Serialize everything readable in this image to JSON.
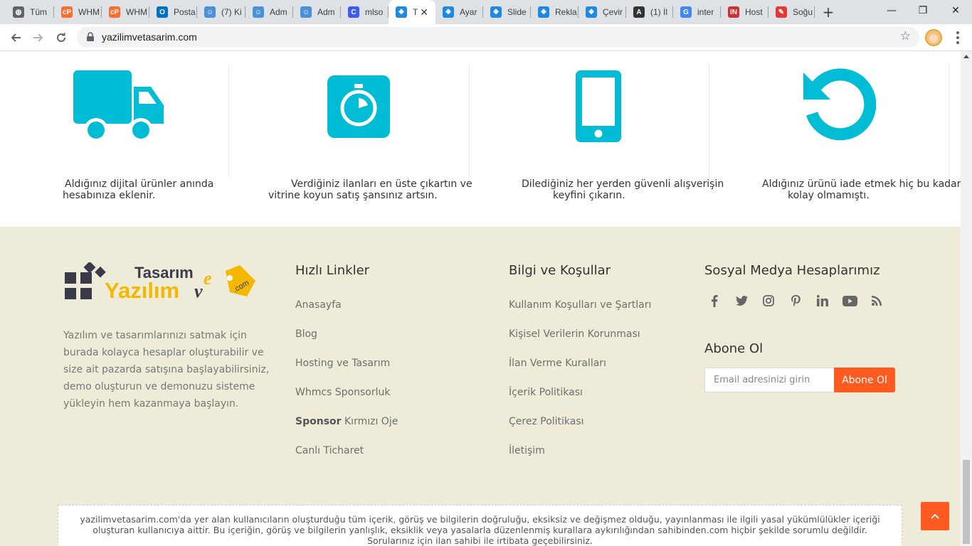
{
  "browser": {
    "tabs": [
      {
        "title": "Tüm",
        "icon": "globe-icon",
        "color": "#5f6368"
      },
      {
        "title": "WHM",
        "icon": "cpanel-icon",
        "color": "#ff6c2c"
      },
      {
        "title": "WHM",
        "icon": "cpanel-icon",
        "color": "#ff6c2c"
      },
      {
        "title": "Posta",
        "icon": "outlook-icon",
        "color": "#0072c6"
      },
      {
        "title": "(7) Ki",
        "icon": "chat-icon",
        "color": "#4a90d9"
      },
      {
        "title": "Adm",
        "icon": "chat-icon",
        "color": "#4a90d9"
      },
      {
        "title": "Adm",
        "icon": "chat-icon",
        "color": "#4a90d9"
      },
      {
        "title": "mlso",
        "icon": "c-icon",
        "color": "#3d5afe"
      },
      {
        "title": "T",
        "icon": "puzzle-icon",
        "color": "#1e88e5"
      },
      {
        "title": "Ayar",
        "icon": "puzzle-icon",
        "color": "#1e88e5"
      },
      {
        "title": "Slide",
        "icon": "puzzle-icon",
        "color": "#1e88e5"
      },
      {
        "title": "Rekla",
        "icon": "puzzle-icon",
        "color": "#1e88e5"
      },
      {
        "title": "Çevir",
        "icon": "puzzle-icon",
        "color": "#1e88e5"
      },
      {
        "title": "(1) İl",
        "icon": "a-icon",
        "color": "#333333"
      },
      {
        "title": "inter",
        "icon": "google-icon",
        "color": "#4285f4"
      },
      {
        "title": "Host",
        "icon": "in-icon",
        "color": "#d32f2f"
      },
      {
        "title": "Soğu",
        "icon": "pin-icon",
        "color": "#e53935"
      }
    ],
    "active_tab": 8,
    "url": "yazilimvetasarim.com",
    "new_tab_symbol": "+",
    "minimize_symbol": "—",
    "maximize_symbol": "❐",
    "close_symbol": "✕"
  },
  "features": [
    {
      "icon": "truck-icon",
      "lines": [
        "Aldığınız dijital ürünler anında",
        "hesabınıza eklenir."
      ]
    },
    {
      "icon": "stopwatch-icon",
      "lines": [
        "Verdiğiniz ilanları en üste çıkartın ve",
        "vitrine koyun satış şansınız artsın."
      ]
    },
    {
      "icon": "mobile-phone-icon",
      "lines": [
        "Dilediğiniz her yerden güvenli alışverişin",
        "keyfini çıkarın."
      ]
    },
    {
      "icon": "undo-icon",
      "lines": [
        "Aldığınız ürünü iade etmek hiç bu kadar",
        "kolay olmamıştı."
      ]
    }
  ],
  "colors": {
    "feature_icon": "#00bcd4",
    "footer_bg": "#efebd9",
    "accent": "#ff5a1f",
    "logo_gold": "#f5b800",
    "logo_dark": "#3a3a4a"
  },
  "footer": {
    "logo": {
      "word1": "Tasarım",
      "word2": "Yazılım",
      "word3": "v",
      "word4": "e",
      "tag": ".com"
    },
    "about_lines": [
      "Yazılım ve tasarımlarınızı satmak için",
      "burada kolayca hesaplar oluşturabilir ve",
      "size ait pazarda satışına başlayabilirsiniz,",
      "demo oluşturun ve demonuzu sisteme",
      "yükleyin hem kazanmaya başlayın."
    ],
    "quick_links": {
      "title": "Hızlı Linkler",
      "items": [
        {
          "bold": "",
          "text": "Anasayfa"
        },
        {
          "bold": "",
          "text": "Blog"
        },
        {
          "bold": "",
          "text": "Hosting ve Tasarım"
        },
        {
          "bold": "",
          "text": "Whmcs Sponsorluk"
        },
        {
          "bold": "Sponsor",
          "text": " Kırmızı Oje"
        },
        {
          "bold": "",
          "text": "Canlı Ticharet"
        }
      ]
    },
    "terms": {
      "title": "Bilgi ve Koşullar",
      "items": [
        "Kullanım Koşulları ve Şartları",
        "Kişisel Verilerin Korunması",
        "İlan Verme Kuralları",
        "İçerik Politikası",
        "Çerez Politikası",
        "İletişim"
      ]
    },
    "social": {
      "title": "Sosyal Medya Hesaplarımız",
      "icons": [
        "facebook-icon",
        "twitter-icon",
        "instagram-icon",
        "pinterest-icon",
        "linkedin-icon",
        "youtube-icon",
        "rss-icon"
      ]
    },
    "subscribe": {
      "title": "Abone Ol",
      "placeholder": "Email adresinizi girin",
      "button": "Abone Ol"
    },
    "disclaimer": "yazilimvetasarim.com'da yer alan kullanıcıların oluşturduğu tüm içerik, görüş ve bilgilerin doğruluğu, eksiksiz ve değişmez olduğu, yayınlanması ile ilgili yasal yükümlülükler içeriği oluşturan kullanıcıya aittir. Bu içeriğin, görüş ve bilgilerin yanlışlık, eksiklik veya yasalarla düzenlenmiş kurallara aykırılığından sahibinden.com hiçbir şekilde sorumlu değildir. Sorularınız için ilan sahibi ile irtibata geçebilirsiniz."
  }
}
